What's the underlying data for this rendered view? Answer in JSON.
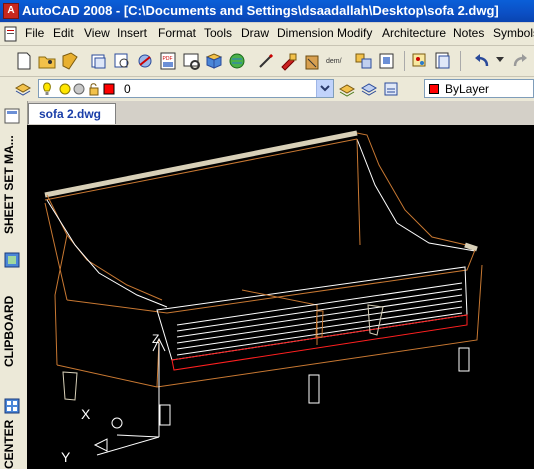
{
  "window": {
    "title": "AutoCAD 2008 - [C:\\Documents and Settings\\dsaadallah\\Desktop\\sofa 2.dwg]"
  },
  "menubar": {
    "items": [
      "File",
      "Edit",
      "View",
      "Insert",
      "Format",
      "Tools",
      "Draw",
      "Dimension",
      "Modify",
      "Architecture",
      "Notes",
      "Symbols"
    ]
  },
  "toolbar": {
    "icons": [
      "new-icon",
      "open-icon",
      "save-icon",
      "print-icon",
      "print-preview-icon",
      "publish-icon",
      "pdf-export-icon",
      "plot-icon",
      "3d-dwf-icon",
      "cut-icon",
      "copy-icon",
      "paste-icon",
      "match-properties-icon",
      "block-editor-icon",
      "undo-icon"
    ],
    "pdf_label": "PDF",
    "demo_label": "dem/"
  },
  "layers": {
    "current_layer": "0",
    "color_value": "ByLayer",
    "color_swatch": "#ff0000"
  },
  "document_tab": {
    "label": "sofa 2.dwg"
  },
  "palettes": {
    "sheet_set": "SHEET SET MA...",
    "clipboard": "CLIPBOARD",
    "center": "CENTER"
  },
  "ucs": {
    "x_label": "X",
    "y_label": "Y",
    "z_label": "Z"
  },
  "colors": {
    "canvas": "#000000",
    "wire": "#ffffff",
    "frame": "#c87832",
    "accent": "#d8d0b8",
    "red_line": "#ff2020"
  }
}
